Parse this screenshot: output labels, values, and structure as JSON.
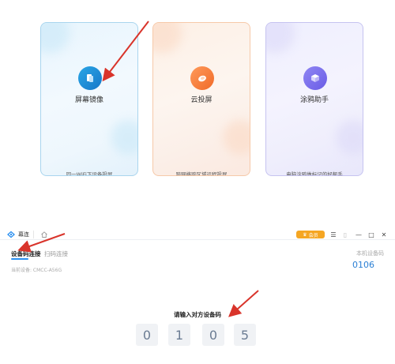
{
  "cards": [
    {
      "title": "屏幕镜像",
      "desc": "同一WiFi下设备投屏",
      "icon": "mirror-icon",
      "accent": "#1677c8"
    },
    {
      "title": "云投屏",
      "desc": "跨网络跨区域远程投屏",
      "icon": "cloud-cast-icon",
      "accent": "#f06a28"
    },
    {
      "title": "涂鸦助手",
      "desc": "电脑涂鸦做标记的好帮手",
      "icon": "doodle-icon",
      "accent": "#6a5ce6"
    }
  ],
  "app": {
    "name": "幕连",
    "vip_label": "会员",
    "tabs": [
      {
        "label": "设备码连接",
        "active": true
      },
      {
        "label": "扫码连接",
        "active": false
      }
    ],
    "device_label": "当前设备: CMCC-A56G",
    "local_code_label": "本机设备码",
    "local_code_value": "0106",
    "prompt": "请输入对方设备码",
    "digits": [
      "0",
      "1",
      "0",
      "5"
    ]
  },
  "colors": {
    "arrow": "#d9342b",
    "accent_blue": "#2a8ff0",
    "vip": "#f5a623"
  }
}
